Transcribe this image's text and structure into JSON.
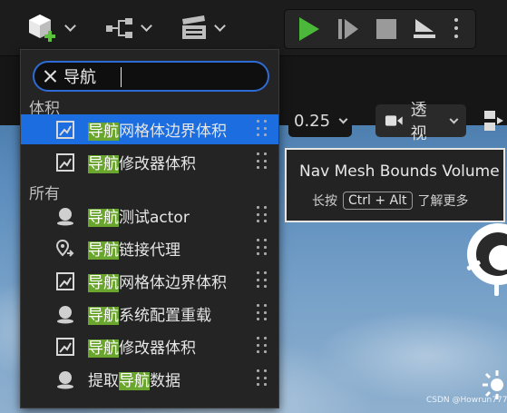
{
  "toolbar": {
    "add_icon": "cube-add-icon",
    "blueprint_icon": "blueprint-nodes-icon",
    "cinematics_icon": "clapperboard-icon",
    "play_icon": "play-icon",
    "step_icon": "step-forward-icon",
    "stop_icon": "stop-icon",
    "eject_icon": "eject-icon",
    "more_icon": "more-vertical-icon",
    "play_color": "#4cb83a"
  },
  "viewport": {
    "snap_value": "0.25",
    "view_mode_label": "透视",
    "sky_color": "#5b8cbd"
  },
  "menu": {
    "search": {
      "value": "导航",
      "placeholder": ""
    },
    "sections": [
      {
        "label": "体积"
      },
      {
        "label": "所有"
      }
    ],
    "items": [
      {
        "pre": "",
        "highlight": "导航",
        "post": "网格体边界体积",
        "icon": "volume-icon",
        "selected": true
      },
      {
        "pre": "",
        "highlight": "导航",
        "post": "修改器体积",
        "icon": "volume-icon",
        "selected": false
      },
      {
        "pre": "",
        "highlight": "导航",
        "post": "测试actor",
        "icon": "actor-icon",
        "selected": false
      },
      {
        "pre": "",
        "highlight": "导航",
        "post": "链接代理",
        "icon": "nav-link-icon",
        "selected": false
      },
      {
        "pre": "",
        "highlight": "导航",
        "post": "网格体边界体积",
        "icon": "volume-icon",
        "selected": false
      },
      {
        "pre": "",
        "highlight": "导航",
        "post": "系统配置重载",
        "icon": "actor-icon",
        "selected": false
      },
      {
        "pre": "",
        "highlight": "导航",
        "post": "修改器体积",
        "icon": "volume-icon",
        "selected": false
      },
      {
        "pre": "提取",
        "highlight": "导航",
        "post": "数据",
        "icon": "actor-icon",
        "selected": false
      }
    ],
    "highlight_color": "#6aa52e",
    "selected_color": "#1b6de0"
  },
  "tooltip": {
    "title": "Nav Mesh Bounds Volume",
    "hold_label": "长按",
    "shortcut": "Ctrl + Alt",
    "more_label": "了解更多"
  },
  "watermark": "CSDN @Howrun777"
}
